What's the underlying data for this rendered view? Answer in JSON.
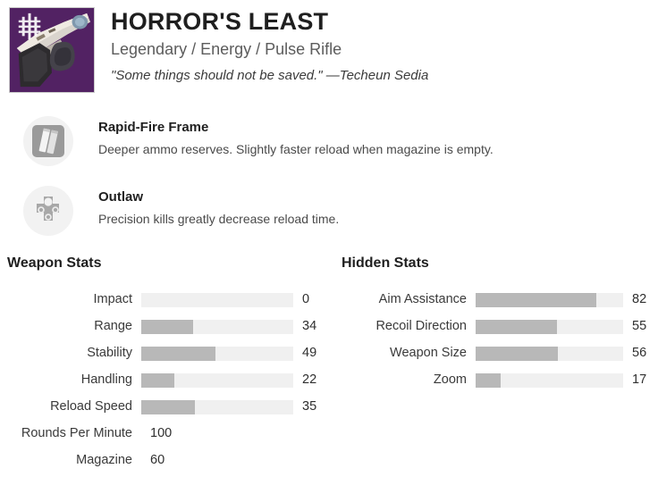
{
  "item": {
    "name": "HORROR'S LEAST",
    "subtitle": "Legendary / Energy / Pulse Rifle",
    "flavor": "\"Some things should not be saved.\" —Techeun Sedia",
    "icon_background_color": "#522263",
    "icon_name": "weapon-icon",
    "watermark_icon": "season-watermark-icon"
  },
  "perks": [
    {
      "name": "Rapid-Fire Frame",
      "description": "Deeper ammo reserves. Slightly faster reload when magazine is empty.",
      "icon_name": "magazine-icon"
    },
    {
      "name": "Outlaw",
      "description": "Precision kills greatly decrease reload time.",
      "icon_name": "revolver-cylinder-icon"
    }
  ],
  "weapon_stats": {
    "heading": "Weapon Stats",
    "rows": [
      {
        "label": "Impact",
        "value": "0",
        "bar": 0,
        "has_bar": true
      },
      {
        "label": "Range",
        "value": "34",
        "bar": 34,
        "has_bar": true
      },
      {
        "label": "Stability",
        "value": "49",
        "bar": 49,
        "has_bar": true
      },
      {
        "label": "Handling",
        "value": "22",
        "bar": 22,
        "has_bar": true
      },
      {
        "label": "Reload Speed",
        "value": "35",
        "bar": 35,
        "has_bar": true
      },
      {
        "label": "Rounds Per Minute",
        "value": "100",
        "bar": 0,
        "has_bar": false
      },
      {
        "label": "Magazine",
        "value": "60",
        "bar": 0,
        "has_bar": false
      }
    ]
  },
  "hidden_stats": {
    "heading": "Hidden Stats",
    "rows": [
      {
        "label": "Aim Assistance",
        "value": "82",
        "bar": 82,
        "has_bar": true
      },
      {
        "label": "Recoil Direction",
        "value": "55",
        "bar": 55,
        "has_bar": true
      },
      {
        "label": "Weapon Size",
        "value": "56",
        "bar": 56,
        "has_bar": true
      },
      {
        "label": "Zoom",
        "value": "17",
        "bar": 17,
        "has_bar": true
      }
    ]
  },
  "colors": {
    "bar_track": "#f0f0f0",
    "bar_fill": "#b8b8b8",
    "rarity_purple": "#522263"
  }
}
